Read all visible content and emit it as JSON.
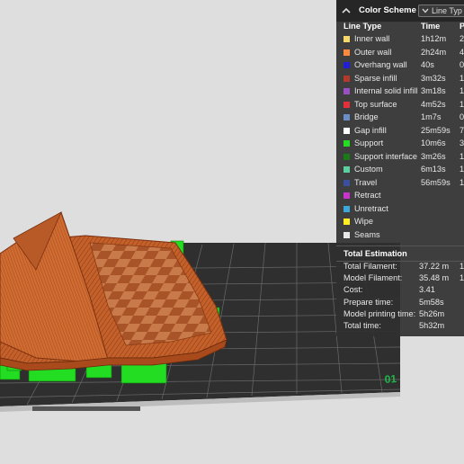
{
  "panel": {
    "title": "Color Scheme",
    "view_select": "Line Typ",
    "columns": {
      "line_type": "Line Type",
      "time": "Time",
      "pct": "P"
    },
    "rows": [
      {
        "label": "Inner wall",
        "time": "1h12m",
        "pct": "2",
        "color": "#f5d86a"
      },
      {
        "label": "Outer wall",
        "time": "2h24m",
        "pct": "4",
        "color": "#ff8a3d"
      },
      {
        "label": "Overhang wall",
        "time": "40s",
        "pct": "0",
        "color": "#1f1fd8"
      },
      {
        "label": "Sparse infill",
        "time": "3m32s",
        "pct": "1",
        "color": "#b23a2a"
      },
      {
        "label": "Internal solid infill",
        "time": "3m18s",
        "pct": "1",
        "color": "#9a4fc4"
      },
      {
        "label": "Top surface",
        "time": "4m52s",
        "pct": "1",
        "color": "#e5303a"
      },
      {
        "label": "Bridge",
        "time": "1m7s",
        "pct": "0",
        "color": "#6a8ec8"
      },
      {
        "label": "Gap infill",
        "time": "25m59s",
        "pct": "7",
        "color": "#ffffff"
      },
      {
        "label": "Support",
        "time": "10m6s",
        "pct": "3",
        "color": "#22dd22"
      },
      {
        "label": "Support interface",
        "time": "3m26s",
        "pct": "1",
        "color": "#1a7a1a"
      },
      {
        "label": "Custom",
        "time": "6m13s",
        "pct": "1",
        "color": "#5ccf9e"
      },
      {
        "label": "Travel",
        "time": "56m59s",
        "pct": "1",
        "color": "#3a4f9e"
      },
      {
        "label": "Retract",
        "time": "",
        "pct": "",
        "color": "#cc33cc"
      },
      {
        "label": "Unretract",
        "time": "",
        "pct": "",
        "color": "#3aa8d8"
      },
      {
        "label": "Wipe",
        "time": "",
        "pct": "",
        "color": "#ffee22"
      },
      {
        "label": "Seams",
        "time": "",
        "pct": "",
        "color": "#e8e8e8"
      }
    ]
  },
  "estimation": {
    "title": "Total Estimation",
    "rows": [
      {
        "label": "Total Filament:",
        "value": "37.22 m",
        "extra": "1"
      },
      {
        "label": "Model Filament:",
        "value": "35.48 m",
        "extra": "1("
      },
      {
        "label": "Cost:",
        "value": "3.41",
        "extra": ""
      },
      {
        "label": "Prepare time:",
        "value": "5m58s",
        "extra": ""
      },
      {
        "label": "Model printing time:",
        "value": "5h26m",
        "extra": ""
      },
      {
        "label": "Total time:",
        "value": "5h32m",
        "extra": ""
      }
    ]
  },
  "plate": {
    "number_label": "01",
    "label_color": "#1fb84a"
  },
  "colors": {
    "model_orange": "#c4602a",
    "support_green": "#22dd22",
    "bed_dark": "#2f2f2f",
    "grid_line": "#6a6a6a",
    "background": "#dedede"
  }
}
